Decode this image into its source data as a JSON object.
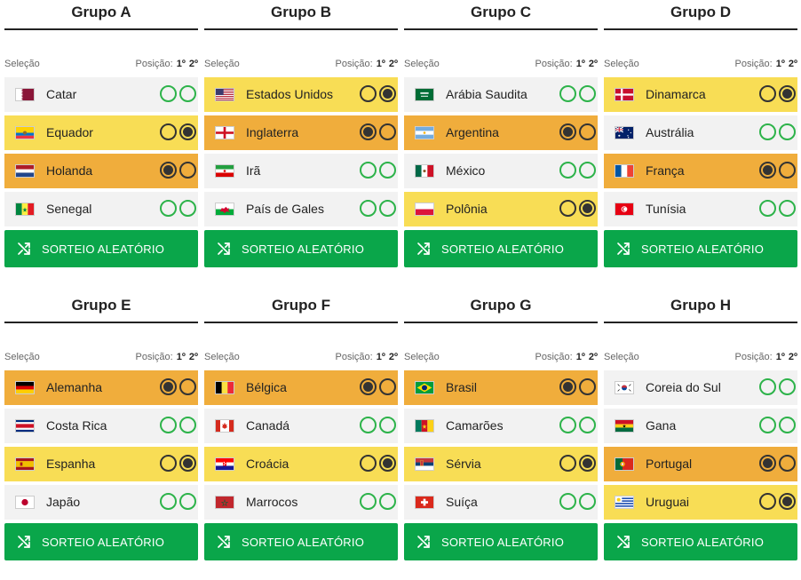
{
  "header": {
    "selecao": "Seleção",
    "posicao": "Posição:",
    "first": "1º",
    "second": "2º"
  },
  "button_label": "SORTEIO ALEATÓRIO",
  "groups": [
    {
      "title": "Grupo A",
      "teams": [
        {
          "name": "Catar",
          "flag": "qatar",
          "pick": 0
        },
        {
          "name": "Equador",
          "flag": "ecuador",
          "pick": 2
        },
        {
          "name": "Holanda",
          "flag": "netherlands",
          "pick": 1
        },
        {
          "name": "Senegal",
          "flag": "senegal",
          "pick": 0
        }
      ]
    },
    {
      "title": "Grupo B",
      "teams": [
        {
          "name": "Estados Unidos",
          "flag": "usa",
          "pick": 2
        },
        {
          "name": "Inglaterra",
          "flag": "england",
          "pick": 1
        },
        {
          "name": "Irã",
          "flag": "iran",
          "pick": 0
        },
        {
          "name": "País de Gales",
          "flag": "wales",
          "pick": 0
        }
      ]
    },
    {
      "title": "Grupo C",
      "teams": [
        {
          "name": "Arábia Saudita",
          "flag": "saudi",
          "pick": 0
        },
        {
          "name": "Argentina",
          "flag": "argentina",
          "pick": 1
        },
        {
          "name": "México",
          "flag": "mexico",
          "pick": 0
        },
        {
          "name": "Polônia",
          "flag": "poland",
          "pick": 2
        }
      ]
    },
    {
      "title": "Grupo D",
      "teams": [
        {
          "name": "Dinamarca",
          "flag": "denmark",
          "pick": 2
        },
        {
          "name": "Austrália",
          "flag": "australia",
          "pick": 0
        },
        {
          "name": "França",
          "flag": "france",
          "pick": 1
        },
        {
          "name": "Tunísia",
          "flag": "tunisia",
          "pick": 0
        }
      ]
    },
    {
      "title": "Grupo E",
      "teams": [
        {
          "name": "Alemanha",
          "flag": "germany",
          "pick": 1
        },
        {
          "name": "Costa Rica",
          "flag": "costarica",
          "pick": 0
        },
        {
          "name": "Espanha",
          "flag": "spain",
          "pick": 2
        },
        {
          "name": "Japão",
          "flag": "japan",
          "pick": 0
        }
      ]
    },
    {
      "title": "Grupo F",
      "teams": [
        {
          "name": "Bélgica",
          "flag": "belgium",
          "pick": 1
        },
        {
          "name": "Canadá",
          "flag": "canada",
          "pick": 0
        },
        {
          "name": "Croácia",
          "flag": "croatia",
          "pick": 2
        },
        {
          "name": "Marrocos",
          "flag": "morocco",
          "pick": 0
        }
      ]
    },
    {
      "title": "Grupo G",
      "teams": [
        {
          "name": "Brasil",
          "flag": "brazil",
          "pick": 1
        },
        {
          "name": "Camarões",
          "flag": "cameroon",
          "pick": 0
        },
        {
          "name": "Sérvia",
          "flag": "serbia",
          "pick": 2
        },
        {
          "name": "Suíça",
          "flag": "switzerland",
          "pick": 0
        }
      ]
    },
    {
      "title": "Grupo H",
      "teams": [
        {
          "name": "Coreia do Sul",
          "flag": "southkorea",
          "pick": 0
        },
        {
          "name": "Gana",
          "flag": "ghana",
          "pick": 0
        },
        {
          "name": "Portugal",
          "flag": "portugal",
          "pick": 1
        },
        {
          "name": "Uruguai",
          "flag": "uruguay",
          "pick": 2
        }
      ]
    }
  ],
  "colors": {
    "first_place": "#f0ad3c",
    "second_place": "#f8dd55",
    "unselected": "#f2f2f2",
    "button": "#0aa64a",
    "radio_open": "#2db34a"
  }
}
